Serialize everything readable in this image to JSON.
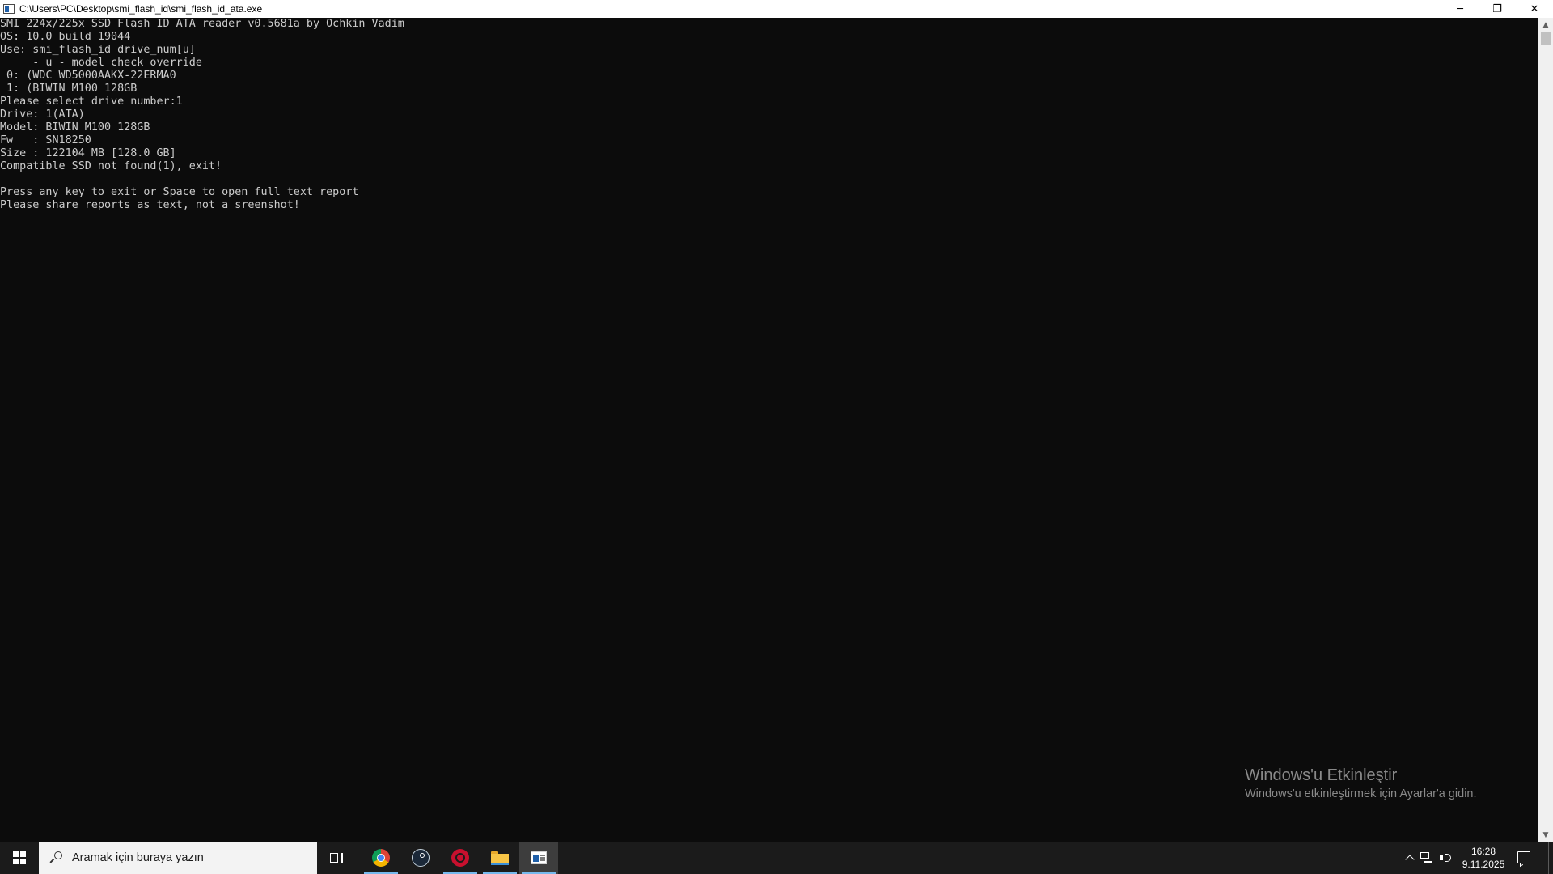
{
  "window": {
    "title": "C:\\Users\\PC\\Desktop\\smi_flash_id\\smi_flash_id_ata.exe",
    "controls": {
      "minimize": "─",
      "restore": "❐",
      "close": "✕"
    }
  },
  "console": {
    "lines": [
      "SMI 224x/225x SSD Flash ID ATA reader v0.5681a by Ochkin Vadim",
      "OS: 10.0 build 19044",
      "Use: smi_flash_id drive_num[u]",
      "     - u - model check override",
      " 0: (WDC WD5000AAKX-22ERMA0",
      " 1: (BIWIN M100 128GB",
      "Please select drive number:1",
      "Drive: 1(ATA)",
      "Model: BIWIN M100 128GB",
      "Fw   : SN18250",
      "Size : 122104 MB [128.0 GB]",
      "Compatible SSD not found(1), exit!",
      "",
      "Press any key to exit or Space to open full text report",
      "Please share reports as text, not a sreenshot!"
    ]
  },
  "scrollbar": {
    "up_arrow": "▲",
    "down_arrow": "▼"
  },
  "watermark": {
    "title": "Windows'u Etkinleştir",
    "subtitle": "Windows'u etkinleştirmek için Ayarlar'a gidin."
  },
  "taskbar": {
    "search_placeholder": "Aramak için buraya yazın",
    "apps": [
      {
        "icon": "chrome-icon",
        "running": true
      },
      {
        "icon": "steam-icon",
        "running": false
      },
      {
        "icon": "red-app-icon",
        "running": true
      },
      {
        "icon": "folder-icon",
        "running": true
      },
      {
        "icon": "console-app-icon",
        "running": true,
        "active": true
      }
    ],
    "clock": {
      "time": "16:28",
      "date": "9.11.2025"
    }
  },
  "colors": {
    "console_bg": "#0c0c0c",
    "console_text": "#cccccc",
    "taskbar_bg": "#1b1b1b",
    "active_app_bg": "#3d3d3d",
    "running_indicator": "#76b9ed"
  }
}
